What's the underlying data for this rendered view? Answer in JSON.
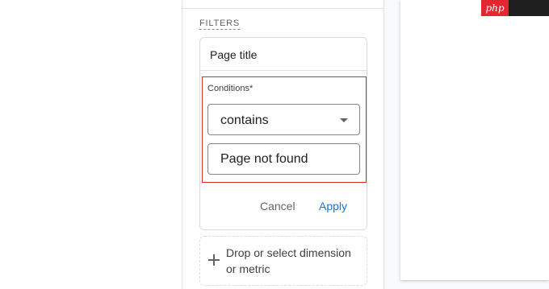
{
  "filters": {
    "heading": "FILTERS",
    "card": {
      "title": "Page title",
      "conditions_label": "Conditions*",
      "operator": "contains",
      "value": "Page not found",
      "cancel_label": "Cancel",
      "apply_label": "Apply"
    },
    "drop_zone_text": "Drop or select dimension or metric"
  },
  "watermark": {
    "text": "php"
  },
  "colors": {
    "accent": "#1a73e8",
    "highlight": "#d93025",
    "watermark_red": "#e3262f",
    "watermark_dark": "#1f1f1f"
  },
  "icons": [
    "chevron-down-icon",
    "plus-icon"
  ]
}
